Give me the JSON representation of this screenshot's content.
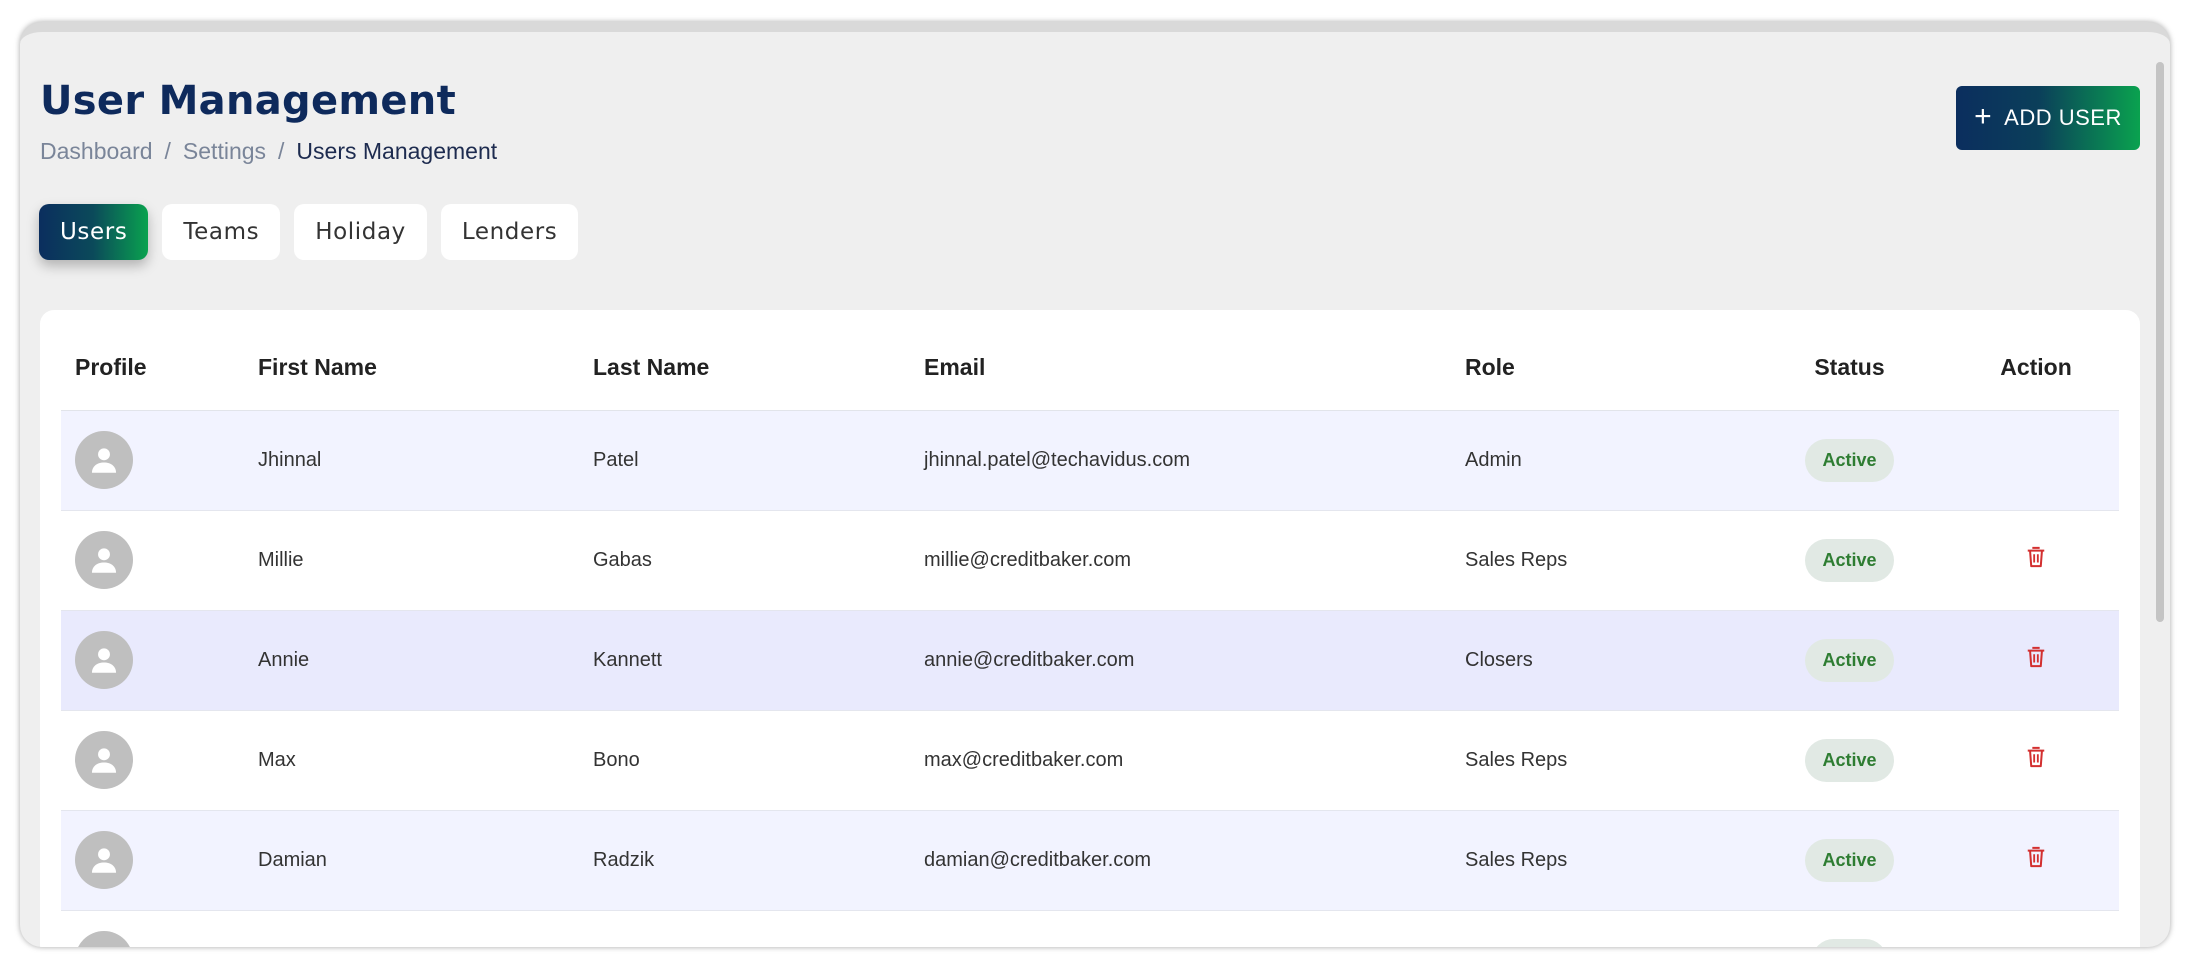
{
  "header": {
    "title": "User Management",
    "breadcrumb": [
      "Dashboard",
      "Settings",
      "Users Management"
    ],
    "breadcrumb_separator": "/",
    "add_button": {
      "icon": "plus-icon",
      "label": "ADD USER"
    }
  },
  "tabs": [
    {
      "label": "Users",
      "active": true
    },
    {
      "label": "Teams",
      "active": false
    },
    {
      "label": "Holiday",
      "active": false
    },
    {
      "label": "Lenders",
      "active": false
    }
  ],
  "table": {
    "columns": [
      "Profile",
      "First Name",
      "Last Name",
      "Email",
      "Role",
      "Status",
      "Action"
    ],
    "rows": [
      {
        "first": "Jhinnal",
        "last": "Patel",
        "email": "jhinnal.patel@techavidus.com",
        "role": "Admin",
        "status": "Active",
        "deletable": false
      },
      {
        "first": "Millie",
        "last": "Gabas",
        "email": "millie@creditbaker.com",
        "role": "Sales Reps",
        "status": "Active",
        "deletable": true
      },
      {
        "first": "Annie",
        "last": "Kannett",
        "email": "annie@creditbaker.com",
        "role": "Closers",
        "status": "Active",
        "deletable": true
      },
      {
        "first": "Max",
        "last": "Bono",
        "email": "max@creditbaker.com",
        "role": "Sales Reps",
        "status": "Active",
        "deletable": true
      },
      {
        "first": "Damian",
        "last": "Radzik",
        "email": "damian@creditbaker.com",
        "role": "Sales Reps",
        "status": "Active",
        "deletable": true
      }
    ]
  },
  "colors": {
    "title": "#0e2a5c",
    "gradient_start": "#0b2e5e",
    "gradient_end": "#0aa24f",
    "status_text": "#2e7d32",
    "delete_icon": "#d32f2f"
  }
}
